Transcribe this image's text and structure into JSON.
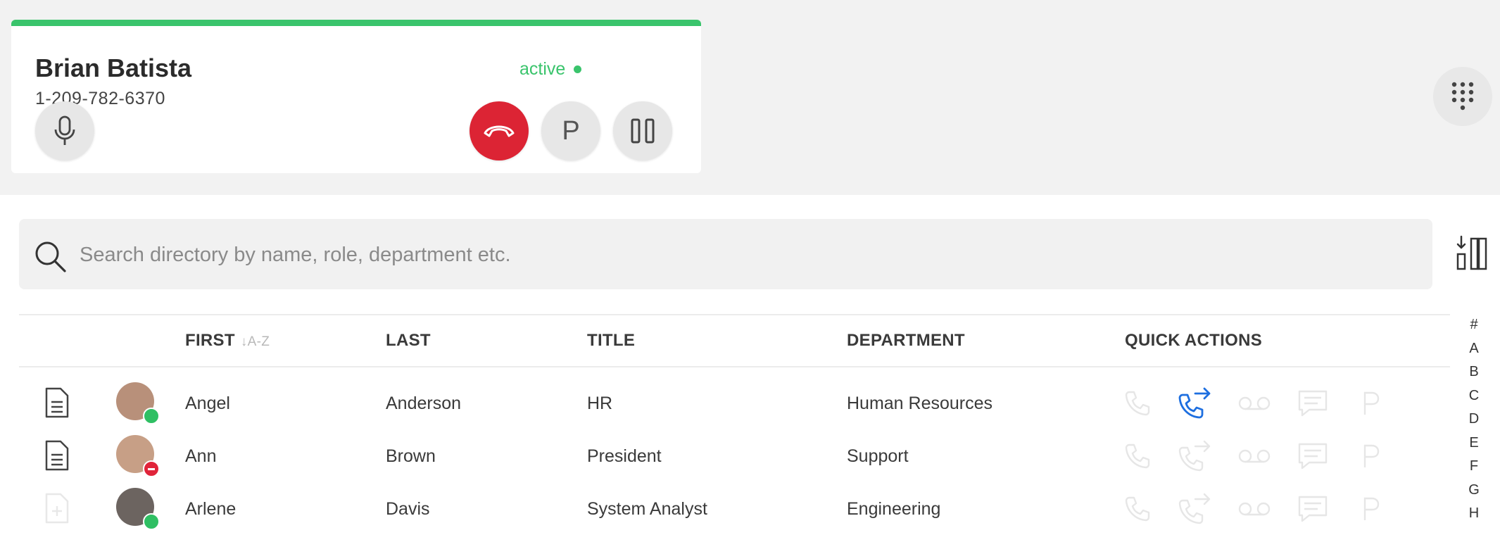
{
  "call": {
    "name": "Brian Batista",
    "phone": "1-209-782-6370",
    "status": "active",
    "park_label": "P",
    "accent_color": "#3ac46c",
    "hangup_color": "#dc2434"
  },
  "search": {
    "placeholder": "Search directory by name, role, department etc."
  },
  "table": {
    "headers": {
      "first": "FIRST",
      "sort_hint": "A-Z",
      "last": "LAST",
      "title": "TITLE",
      "department": "DEPARTMENT",
      "quick_actions": "QUICK ACTIONS"
    },
    "rows": [
      {
        "first": "Angel",
        "last": "Anderson",
        "title": "HR",
        "department": "Human Resources",
        "presence": "available"
      },
      {
        "first": "Ann",
        "last": "Brown",
        "title": "President",
        "department": "Support",
        "presence": "busy"
      },
      {
        "first": "Arlene",
        "last": "Davis",
        "title": "System Analyst",
        "department": "Engineering",
        "presence": "available"
      }
    ]
  },
  "alphabet": [
    "#",
    "A",
    "B",
    "C",
    "D",
    "E",
    "F",
    "G",
    "H"
  ],
  "quick_action_icons": [
    "phone-icon",
    "call-transfer-icon",
    "voicemail-icon",
    "chat-icon",
    "park-icon"
  ]
}
